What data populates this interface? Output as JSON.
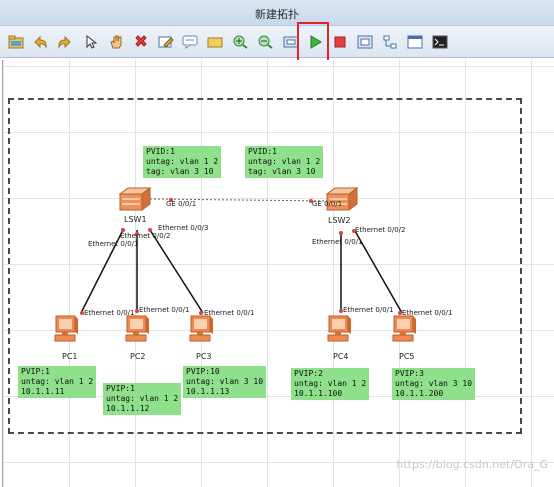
{
  "window": {
    "title": "新建拓扑"
  },
  "toolbar": {
    "buttons": [
      {
        "name": "open-folder-icon",
        "color": "#d4a017"
      },
      {
        "name": "undo-icon",
        "color": "#d4a017"
      },
      {
        "name": "redo-icon",
        "color": "#d4a017"
      },
      {
        "name": "select-pointer-icon",
        "color": "#555555"
      },
      {
        "name": "hand-pan-icon",
        "color": "#d8a04a"
      },
      {
        "name": "delete-icon",
        "color": "#d0302c"
      },
      {
        "name": "edit-text-icon",
        "color": "#4a6fa5"
      },
      {
        "name": "comment-icon",
        "color": "#6b87b5"
      },
      {
        "name": "rectangle-icon",
        "color": "#e0b030"
      },
      {
        "name": "zoom-in-icon",
        "color": "#2e8b2e"
      },
      {
        "name": "zoom-out-icon",
        "color": "#2e8b2e"
      },
      {
        "name": "fit-view-icon",
        "color": "#4a6fa5"
      },
      {
        "name": "start-device-icon",
        "color": "#2ea02e"
      },
      {
        "name": "stop-device-icon",
        "color": "#d0302c"
      },
      {
        "name": "capture-icon",
        "color": "#4a6fa5"
      },
      {
        "name": "topology-icon",
        "color": "#4a6fa5"
      },
      {
        "name": "window-icon",
        "color": "#4a6fa5"
      },
      {
        "name": "console-icon",
        "color": "#333333"
      }
    ]
  },
  "devices": {
    "lsw1": {
      "name": "LSW1"
    },
    "lsw2": {
      "name": "LSW2"
    },
    "pc1": {
      "name": "PC1"
    },
    "pc2": {
      "name": "PC2"
    },
    "pc3": {
      "name": "PC3"
    },
    "pc4": {
      "name": "PC4"
    },
    "pc5": {
      "name": "PC5"
    }
  },
  "ports": {
    "lsw1_ge": "GE 0/0/1",
    "lsw2_ge": "GE 0/0/1",
    "lsw1_e1": "Ethernet 0/0/1",
    "lsw1_e2": "Ethernet 0/0/2",
    "lsw1_e3": "Ethernet 0/0/3",
    "lsw2_e1": "Ethernet 0/0/1",
    "lsw2_e2": "Ethernet 0/0/2",
    "pc1_e": "Ethernet 0/0/1",
    "pc2_e": "Ethernet 0/0/1",
    "pc3_e": "Ethernet 0/0/1",
    "pc4_e": "Ethernet 0/0/1",
    "pc5_e": "Ethernet 0/0/1"
  },
  "notes": {
    "lsw1": [
      "PVID:1",
      "untag: vlan 1 2",
      "tag: vlan 3 10"
    ],
    "lsw2": [
      "PVID:1",
      "untag: vlan 1 2",
      "tag: vlan 3 10"
    ],
    "pc1": [
      "PVIP:1",
      "untag: vlan 1 2",
      "10.1.1.11"
    ],
    "pc2": [
      "PVIP:1",
      "untag: vlan 1 2",
      "10.1.1.12"
    ],
    "pc3": [
      "PVIP:10",
      "untag: vlan 3 10",
      "10.1.1.13"
    ],
    "pc4": [
      "PVIP:2",
      "untag: vlan 1 2",
      "10.1.1.100"
    ],
    "pc5": [
      "PVIP:3",
      "untag: vlan 3 10",
      "10.1.1.200"
    ]
  },
  "watermark": "https://blog.csdn.net/Ora_G",
  "colors": {
    "note_bg": "#8fe08a",
    "link_dot": "#e04040",
    "highlight": "#e0262a"
  }
}
